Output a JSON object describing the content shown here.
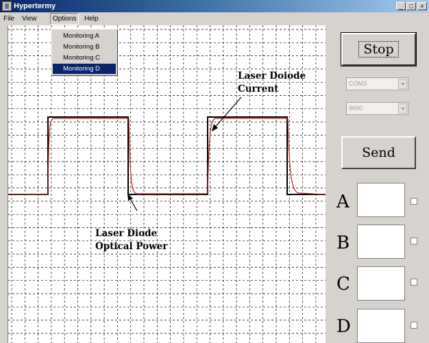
{
  "window": {
    "title": "Hypertermy",
    "controls": {
      "minimize": "_",
      "maximize": "□",
      "close": "×"
    }
  },
  "menubar": {
    "items": [
      "File",
      "View",
      "Options",
      "Help"
    ]
  },
  "options_menu": {
    "items": [
      "Monitoring A",
      "Monitoring B",
      "Monitoring C",
      "Monitoring D"
    ],
    "selected": "Monitoring D"
  },
  "plot": {
    "background": "#ffffff",
    "grid_color": "#000000",
    "current_trace_color": "#000000",
    "power_trace_color": "#b22222"
  },
  "annotations": {
    "current": [
      "Laser Doiode",
      "Current"
    ],
    "power": [
      "Laser Diode",
      "Optical Power"
    ]
  },
  "controls": {
    "stop_label": "Stop",
    "port_value": "COM3",
    "baud_value": "9600",
    "send_label": "Send"
  },
  "channels": [
    {
      "letter": "A"
    },
    {
      "letter": "B"
    },
    {
      "letter": "C"
    },
    {
      "letter": "D"
    }
  ]
}
